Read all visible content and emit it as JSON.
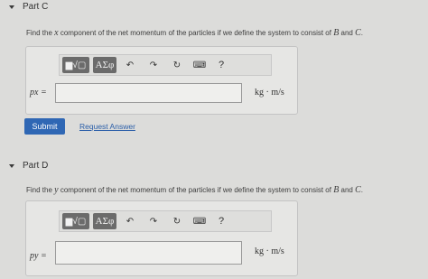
{
  "part_c": {
    "title": "Part C",
    "question_before": "Find the ",
    "question_var": "x",
    "question_middle": " component of the net momentum of the particles if we define the system to consist of ",
    "question_b": "B",
    "question_and": " and ",
    "question_c": "C",
    "question_end": ".",
    "toolbar": {
      "templates_label": "▆√▢",
      "symbols_label": "ΑΣφ",
      "undo_label": "↶",
      "redo_label": "↷",
      "reset_label": "↻",
      "keyboard_label": "⌨",
      "help_label": "?"
    },
    "input_label": "px =",
    "input_value": "",
    "unit": "kg · m/s",
    "submit_label": "Submit",
    "request_label": "Request Answer"
  },
  "part_d": {
    "title": "Part D",
    "question_before": "Find the ",
    "question_var": "y",
    "question_middle": " component of the net momentum of the particles if we define the system to consist of ",
    "question_b": "B",
    "question_and": " and ",
    "question_c": "C",
    "question_end": ".",
    "toolbar": {
      "templates_label": "▆√▢",
      "symbols_label": "ΑΣφ",
      "undo_label": "↶",
      "redo_label": "↷",
      "reset_label": "↻",
      "keyboard_label": "⌨",
      "help_label": "?"
    },
    "input_label": "py =",
    "input_value": "",
    "unit": "kg · m/s"
  },
  "colors": {
    "submit": "#2f67b4",
    "link": "#2a5ea8",
    "toolbar_dark": "#6b6b6b",
    "background": "#dcdcda"
  }
}
